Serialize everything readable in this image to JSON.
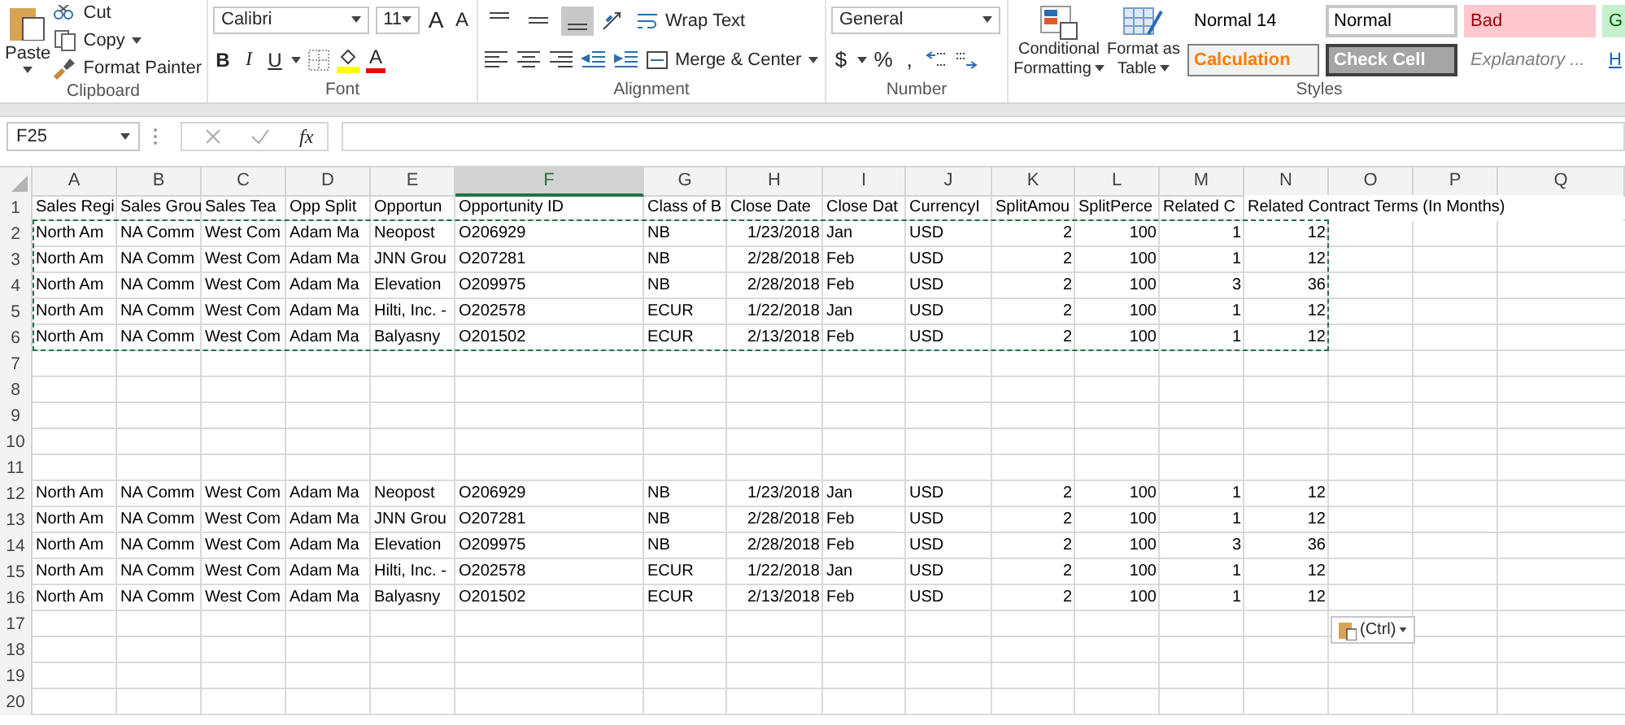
{
  "clipboard": {
    "paste": "Paste",
    "cut": "Cut",
    "copy": "Copy",
    "format_painter": "Format Painter",
    "label": "Clipboard"
  },
  "font": {
    "name": "Calibri",
    "size": "11",
    "grow": "A",
    "shrink": "A",
    "bold": "B",
    "italic": "I",
    "underline": "U",
    "font_color": "A",
    "label": "Font"
  },
  "alignment": {
    "vertical_align": [
      {
        "selected": false
      },
      {
        "selected": false
      },
      {
        "selected": true
      }
    ],
    "wrap_text": "Wrap Text",
    "merge": "Merge & Center",
    "label": "Alignment"
  },
  "number": {
    "format": "General",
    "currency": "$",
    "percent": "%",
    "comma": ",",
    "label": "Number"
  },
  "styles": {
    "conditional": "Conditional Formatting",
    "format_table": "Format as Table",
    "label": "Styles",
    "gallery": [
      {
        "text": "Normal 14",
        "kind": "plain",
        "selected": false
      },
      {
        "text": "Normal",
        "kind": "plain",
        "selected": true
      },
      {
        "text": "Bad",
        "kind": "bad",
        "selected": false
      },
      {
        "text": "G",
        "kind": "good",
        "selected": false
      },
      {
        "text": "Calculation",
        "kind": "calculation",
        "selected": false
      },
      {
        "text": "Check Cell",
        "kind": "check",
        "selected": false
      },
      {
        "text": "Explanatory ...",
        "kind": "explanatory",
        "selected": false
      },
      {
        "text": "H",
        "kind": "hyperlink",
        "selected": false
      }
    ]
  },
  "formula_bar": {
    "name_box": "F25",
    "fx": "fx"
  },
  "sheet": {
    "columns": [
      {
        "label": "A",
        "kind": "text",
        "selected": false
      },
      {
        "label": "B",
        "kind": "text",
        "selected": false
      },
      {
        "label": "C",
        "kind": "text",
        "selected": false
      },
      {
        "label": "D",
        "kind": "text",
        "selected": false
      },
      {
        "label": "E",
        "kind": "text",
        "selected": false
      },
      {
        "label": "F",
        "kind": "text",
        "selected": true
      },
      {
        "label": "G",
        "kind": "text",
        "selected": false
      },
      {
        "label": "H",
        "kind": "number",
        "selected": false
      },
      {
        "label": "I",
        "kind": "text",
        "selected": false
      },
      {
        "label": "J",
        "kind": "text",
        "selected": false
      },
      {
        "label": "K",
        "kind": "number",
        "selected": false
      },
      {
        "label": "L",
        "kind": "number",
        "selected": false
      },
      {
        "label": "M",
        "kind": "number",
        "selected": false
      },
      {
        "label": "N",
        "kind": "number",
        "selected": false
      },
      {
        "label": "O",
        "selected": false
      },
      {
        "label": "P",
        "selected": false
      },
      {
        "label": "Q",
        "selected": false
      }
    ],
    "rows": [
      {
        "number": "1",
        "kind": "header",
        "copied": false,
        "cells": [
          "Sales Regi",
          "Sales Grou",
          "Sales Tea",
          "Opp Split",
          "Opportun",
          "Opportunity ID",
          "Class of B",
          "Close Date",
          "Close Dat",
          "CurrencyI",
          "SplitAmou",
          "SplitPerce",
          "Related C",
          "Related Contract Terms (In Months)"
        ]
      },
      {
        "number": "2",
        "kind": "data",
        "copied": true,
        "cells": [
          "North Am",
          "NA Comm",
          "West Com",
          "Adam Ma",
          "Neopost",
          "O206929",
          "NB",
          "1/23/2018",
          "Jan",
          "USD",
          "2",
          "100",
          "1",
          "12"
        ]
      },
      {
        "number": "3",
        "kind": "data",
        "copied": true,
        "cells": [
          "North Am",
          "NA Comm",
          "West Com",
          "Adam Ma",
          "JNN Grou",
          "O207281",
          "NB",
          "2/28/2018",
          "Feb",
          "USD",
          "2",
          "100",
          "1",
          "12"
        ]
      },
      {
        "number": "4",
        "kind": "data",
        "copied": true,
        "cells": [
          "North Am",
          "NA Comm",
          "West Com",
          "Adam Ma",
          "Elevation",
          "O209975",
          "NB",
          "2/28/2018",
          "Feb",
          "USD",
          "2",
          "100",
          "3",
          "36"
        ]
      },
      {
        "number": "5",
        "kind": "data",
        "copied": true,
        "cells": [
          "North Am",
          "NA Comm",
          "West Com",
          "Adam Ma",
          "Hilti, Inc. -",
          "O202578",
          "ECUR",
          "1/22/2018",
          "Jan",
          "USD",
          "2",
          "100",
          "1",
          "12"
        ]
      },
      {
        "number": "6",
        "kind": "data",
        "copied": true,
        "cells": [
          "North Am",
          "NA Comm",
          "West Com",
          "Adam Ma",
          "Balyasny",
          "O201502",
          "ECUR",
          "2/13/2018",
          "Feb",
          "USD",
          "2",
          "100",
          "1",
          "12"
        ]
      },
      {
        "number": "7",
        "copied": false,
        "cells": []
      },
      {
        "number": "8",
        "copied": false,
        "cells": []
      },
      {
        "number": "9",
        "copied": false,
        "cells": []
      },
      {
        "number": "10",
        "copied": false,
        "cells": []
      },
      {
        "number": "11",
        "copied": false,
        "cells": []
      },
      {
        "number": "12",
        "kind": "data",
        "copied": false,
        "cells": [
          "North Am",
          "NA Comm",
          "West Com",
          "Adam Ma",
          "Neopost",
          "O206929",
          "NB",
          "1/23/2018",
          "Jan",
          "USD",
          "2",
          "100",
          "1",
          "12"
        ]
      },
      {
        "number": "13",
        "kind": "data",
        "copied": false,
        "cells": [
          "North Am",
          "NA Comm",
          "West Com",
          "Adam Ma",
          "JNN Grou",
          "O207281",
          "NB",
          "2/28/2018",
          "Feb",
          "USD",
          "2",
          "100",
          "1",
          "12"
        ]
      },
      {
        "number": "14",
        "kind": "data",
        "copied": false,
        "cells": [
          "North Am",
          "NA Comm",
          "West Com",
          "Adam Ma",
          "Elevation",
          "O209975",
          "NB",
          "2/28/2018",
          "Feb",
          "USD",
          "2",
          "100",
          "3",
          "36"
        ]
      },
      {
        "number": "15",
        "kind": "data",
        "copied": false,
        "cells": [
          "North Am",
          "NA Comm",
          "West Com",
          "Adam Ma",
          "Hilti, Inc. -",
          "O202578",
          "ECUR",
          "1/22/2018",
          "Jan",
          "USD",
          "2",
          "100",
          "1",
          "12"
        ]
      },
      {
        "number": "16",
        "kind": "data",
        "copied": false,
        "cells": [
          "North Am",
          "NA Comm",
          "West Com",
          "Adam Ma",
          "Balyasny",
          "O201502",
          "ECUR",
          "2/13/2018",
          "Feb",
          "USD",
          "2",
          "100",
          "1",
          "12"
        ]
      },
      {
        "number": "17",
        "copied": false,
        "cells": []
      },
      {
        "number": "18",
        "copied": false,
        "cells": []
      },
      {
        "number": "19",
        "copied": false,
        "cells": []
      },
      {
        "number": "20",
        "copied": false,
        "cells": []
      }
    ]
  },
  "paste_options": {
    "label": "(Ctrl)"
  }
}
